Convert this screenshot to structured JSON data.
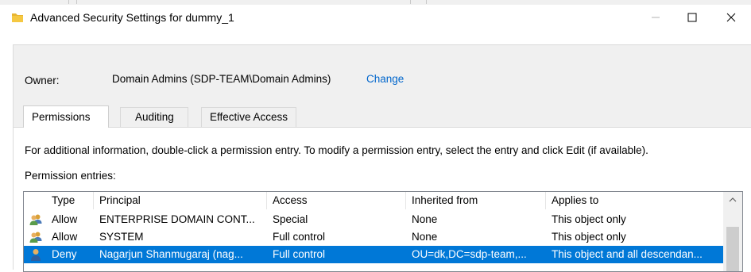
{
  "window": {
    "title": "Advanced Security Settings for dummy_1",
    "minimize_glyph": "—",
    "maximize_glyph": "☐",
    "close_glyph": "✕"
  },
  "owner": {
    "label": "Owner:",
    "value": "Domain Admins (SDP-TEAM\\Domain Admins)",
    "change_link": "Change"
  },
  "tabs": [
    {
      "label": "Permissions",
      "active": true
    },
    {
      "label": "Auditing",
      "active": false
    },
    {
      "label": "Effective Access",
      "active": false
    }
  ],
  "permissions": {
    "info_text": "For additional information, double-click a permission entry. To modify a permission entry, select the entry and click Edit (if available).",
    "entries_label": "Permission entries:",
    "columns": [
      "Type",
      "Principal",
      "Access",
      "Inherited from",
      "Applies to"
    ],
    "rows": [
      {
        "icon": "group-users-icon",
        "type": "Allow",
        "principal": "ENTERPRISE DOMAIN CONT...",
        "access": "Special",
        "inherited_from": "None",
        "applies_to": "This object only",
        "selected": false
      },
      {
        "icon": "group-users-icon",
        "type": "Allow",
        "principal": "SYSTEM",
        "access": "Full control",
        "inherited_from": "None",
        "applies_to": "This object only",
        "selected": false
      },
      {
        "icon": "user-icon",
        "type": "Deny",
        "principal": "Nagarjun Shanmugaraj (nag...",
        "access": "Full control",
        "inherited_from": "OU=dk,DC=sdp-team,...",
        "applies_to": "This object and all descendan...",
        "selected": true
      }
    ]
  },
  "colors": {
    "link": "#0066cc",
    "selection": "#0078d7",
    "folder": "#e8b531"
  }
}
